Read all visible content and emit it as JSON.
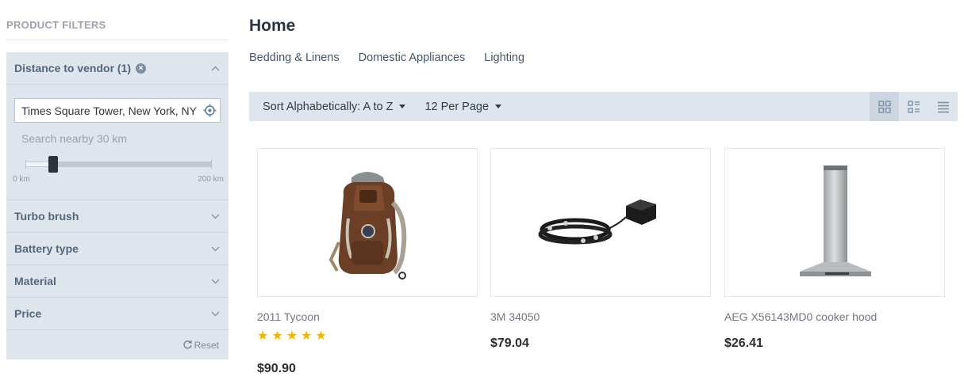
{
  "sidebar": {
    "title": "PRODUCT FILTERS",
    "distance": {
      "label": "Distance to vendor (1)",
      "location_value": "Times Square Tower, New York, NY",
      "nearby_text": "Search nearby 30 km",
      "min_label": "0 km",
      "max_label": "200 km",
      "slider_value_km": 30,
      "slider_max_km": 200
    },
    "filters": [
      {
        "label": "Turbo brush"
      },
      {
        "label": "Battery type"
      },
      {
        "label": "Material"
      },
      {
        "label": "Price"
      }
    ],
    "reset_label": "Reset"
  },
  "main": {
    "title": "Home",
    "subcategories": [
      "Bedding & Linens",
      "Domestic Appliances",
      "Lighting"
    ],
    "sort_label": "Sort Alphabetically: A to Z",
    "per_page_label": "12 Per Page",
    "view_modes": [
      "grid-view-icon",
      "list-view-icon",
      "compact-list-icon"
    ],
    "active_view": "grid-view-icon"
  },
  "products": [
    {
      "name": "2011 Tycoon",
      "price": "$90.90",
      "rating": 5,
      "image": "backpack"
    },
    {
      "name": "3M 34050",
      "price": "$79.04",
      "rating": 0,
      "image": "led-strip"
    },
    {
      "name": "AEG X56143MD0 cooker hood",
      "price": "$26.41",
      "rating": 0,
      "image": "cooker-hood"
    }
  ],
  "colors": {
    "accent": "#55657a",
    "star": "#f5b301",
    "panel": "#dfe5ec"
  }
}
